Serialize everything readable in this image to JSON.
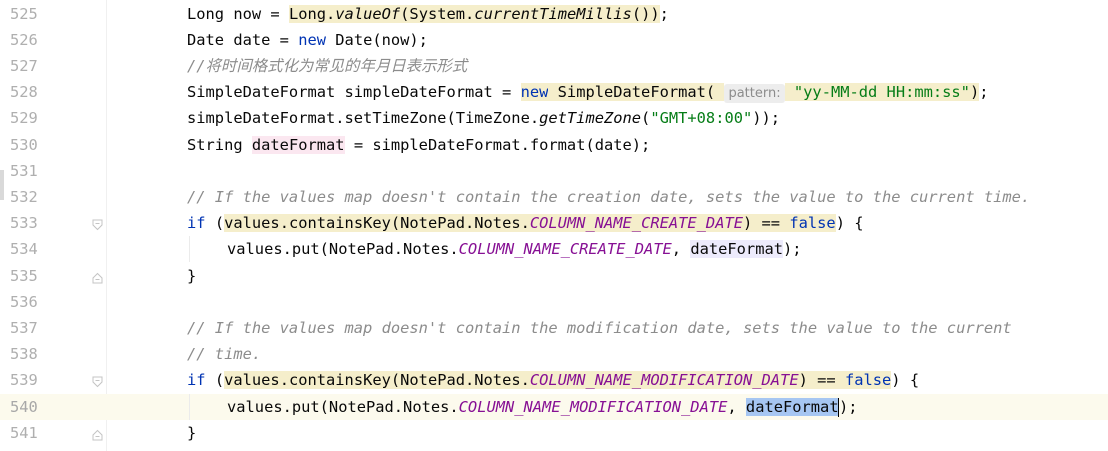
{
  "lines": [
    {
      "number": "525",
      "parts": [
        {
          "text": "Long now = "
        },
        {
          "text": "Long.",
          "cls": "hl"
        },
        {
          "text": "valueOf",
          "cls": "hl stat"
        },
        {
          "text": "(System.",
          "cls": "hl"
        },
        {
          "text": "currentTimeMillis",
          "cls": "hl stat"
        },
        {
          "text": "())",
          "cls": "hl"
        },
        {
          "text": ";"
        }
      ]
    },
    {
      "number": "526",
      "parts": [
        {
          "text": "Date date = "
        },
        {
          "text": "new",
          "cls": "kw"
        },
        {
          "text": " Date(now);"
        }
      ]
    },
    {
      "number": "527",
      "parts": [
        {
          "text": "//将时间格式化为常见的年月日表示形式",
          "cls": "cmt"
        }
      ]
    },
    {
      "number": "528",
      "parts": [
        {
          "text": "SimpleDateFormat simpleDateFormat = "
        },
        {
          "text": "new",
          "cls": "kw hl"
        },
        {
          "text": " SimpleDateFormat( ",
          "cls": "hl"
        },
        {
          "text": "pattern:",
          "cls": "hint"
        },
        {
          "text": " ",
          "cls": "hl"
        },
        {
          "text": "\"yy-MM-dd HH:mm:ss\"",
          "cls": "str hl"
        },
        {
          "text": ")",
          "cls": "hl"
        },
        {
          "text": ";"
        }
      ]
    },
    {
      "number": "529",
      "parts": [
        {
          "text": "simpleDateFormat.setTimeZone(TimeZone."
        },
        {
          "text": "getTimeZone",
          "cls": "stat"
        },
        {
          "text": "("
        },
        {
          "text": "\"GMT+08:00\"",
          "cls": "str"
        },
        {
          "text": "));"
        }
      ]
    },
    {
      "number": "530",
      "parts": [
        {
          "text": "String "
        },
        {
          "text": "dateFormat",
          "cls": "rhl"
        },
        {
          "text": " = simpleDateFormat.format(date);"
        }
      ]
    },
    {
      "number": "531",
      "parts": []
    },
    {
      "number": "532",
      "parts": [
        {
          "text": "// If the values map doesn't contain the creation date, sets the value to the current time.",
          "cls": "cmt"
        }
      ]
    },
    {
      "number": "533",
      "fold": "open",
      "parts": [
        {
          "text": "if",
          "cls": "kw"
        },
        {
          "text": " ("
        },
        {
          "text": "values.containsKey(NotePad.Notes.",
          "cls": "hl"
        },
        {
          "text": "COLUMN_NAME_CREATE_DATE",
          "cls": "cnst hl"
        },
        {
          "text": ") == ",
          "cls": "hl"
        },
        {
          "text": "false",
          "cls": "kw hl"
        },
        {
          "text": ") {"
        }
      ]
    },
    {
      "number": "534",
      "indent": 2,
      "parts": [
        {
          "text": "values.put(NotePad.Notes."
        },
        {
          "text": "COLUMN_NAME_CREATE_DATE",
          "cls": "cnst"
        },
        {
          "text": ", "
        },
        {
          "text": "dateFormat",
          "cls": "use"
        },
        {
          "text": ");"
        }
      ]
    },
    {
      "number": "535",
      "fold": "close",
      "parts": [
        {
          "text": "}"
        }
      ]
    },
    {
      "number": "536",
      "parts": []
    },
    {
      "number": "537",
      "parts": [
        {
          "text": "// If the values map doesn't contain the modification date, sets the value to the current",
          "cls": "cmt"
        }
      ]
    },
    {
      "number": "538",
      "parts": [
        {
          "text": "// time.",
          "cls": "cmt"
        }
      ]
    },
    {
      "number": "539",
      "fold": "open",
      "parts": [
        {
          "text": "if",
          "cls": "kw"
        },
        {
          "text": " ("
        },
        {
          "text": "values.containsKey(NotePad.Notes.",
          "cls": "hl"
        },
        {
          "text": "COLUMN_NAME_MODIFICATION_DATE",
          "cls": "cnst hl"
        },
        {
          "text": ") == ",
          "cls": "hl"
        },
        {
          "text": "false",
          "cls": "kw hl"
        },
        {
          "text": ") {"
        }
      ]
    },
    {
      "number": "540",
      "indent": 2,
      "current": true,
      "parts": [
        {
          "text": "values.put(NotePad.Notes."
        },
        {
          "text": "COLUMN_NAME_MODIFICATION_DATE",
          "cls": "cnst"
        },
        {
          "text": ", "
        },
        {
          "text": "dateForma",
          "cls": "sel"
        },
        {
          "text": "t",
          "cls": "sel",
          "caret": true
        },
        {
          "text": ");"
        }
      ]
    },
    {
      "number": "541",
      "fold": "close",
      "parts": [
        {
          "text": "}"
        }
      ]
    }
  ],
  "colors": {
    "keyword": "#0033b3",
    "string": "#067d17",
    "comment": "#8c8c8c",
    "constant": "#871094",
    "highlight": "#f5eecb",
    "selection": "#a6c6f2",
    "current_line": "#fcfaed"
  },
  "icons": {
    "fold_open": "fold-open-icon",
    "fold_close": "fold-close-icon"
  }
}
